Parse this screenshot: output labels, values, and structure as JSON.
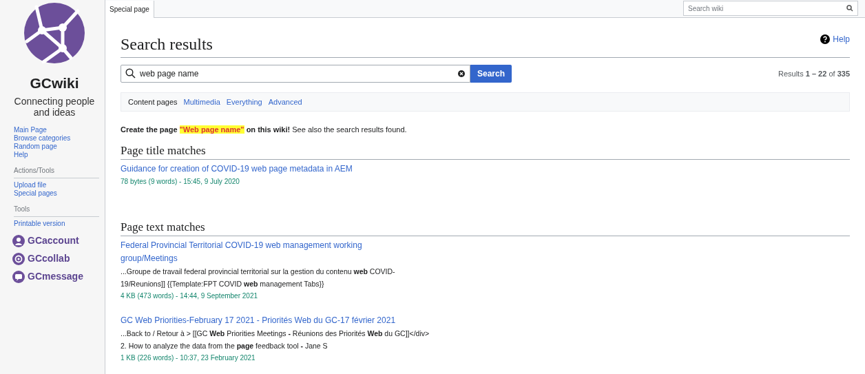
{
  "sidebar": {
    "site_name": "GCwiki",
    "tagline": "Connecting people and ideas",
    "sections": [
      {
        "items": [
          "Main Page",
          "Browse categories",
          "Random page",
          "Help"
        ]
      },
      {
        "heading": "Actions/Tools",
        "items": [
          "Upload file",
          "Special pages"
        ]
      },
      {
        "heading": "Tools",
        "items": [
          "Printable version"
        ]
      }
    ],
    "apps": [
      "GCaccount",
      "GCcollab",
      "GCmessage"
    ]
  },
  "tabs": [
    {
      "label": "Special page",
      "selected": true
    }
  ],
  "wiki_search": {
    "placeholder": "Search wiki"
  },
  "page": {
    "title": "Search results",
    "help": "Help",
    "search": {
      "value": "web page name",
      "button": "Search"
    },
    "results_count": "Results **1 – 22** of **335**",
    "filters": [
      {
        "label": "Content pages",
        "selected": true
      },
      {
        "label": "Multimedia",
        "selected": false
      },
      {
        "label": "Everything",
        "selected": false
      },
      {
        "label": "Advanced",
        "selected": false
      }
    ],
    "create_message": {
      "before": "Create the page",
      "link": "\"Web page name\"",
      "after": "on this wiki!",
      "rest": "See also the search results found."
    },
    "sections": [
      {
        "heading": "Page title matches",
        "results": [
          {
            "title": "Guidance for creation of COVID-19 web page metadata in AEM",
            "meta": "78 bytes (9 words) - 15:45, 9 July 2020"
          }
        ]
      },
      {
        "heading": "Page text matches",
        "results": [
          {
            "title": "Federal Provincial Territorial COVID-19 web management working group/Meetings",
            "snippet": "...Groupe de travail federal provincial territorial sur la gestion du contenu **web** COVID-19/Reunions]] {{Template:FPT COVID **web** management Tabs}}",
            "meta": "4 KB (473 words) - 14:44, 9 September 2021"
          },
          {
            "title": "GC Web Priorities-February 17 2021 - Priorités Web du GC-17 février 2021",
            "snippet": "...Back to / Retour à > [[GC **Web** Priorities Meetings **-** Réunions des Priorités **Web** du GC]]</div> 2. How to analyze the data from the **page** feedback tool **-** Jane S",
            "meta": "1 KB (226 words) - 10:37, 23 February 2021"
          }
        ]
      }
    ]
  }
}
